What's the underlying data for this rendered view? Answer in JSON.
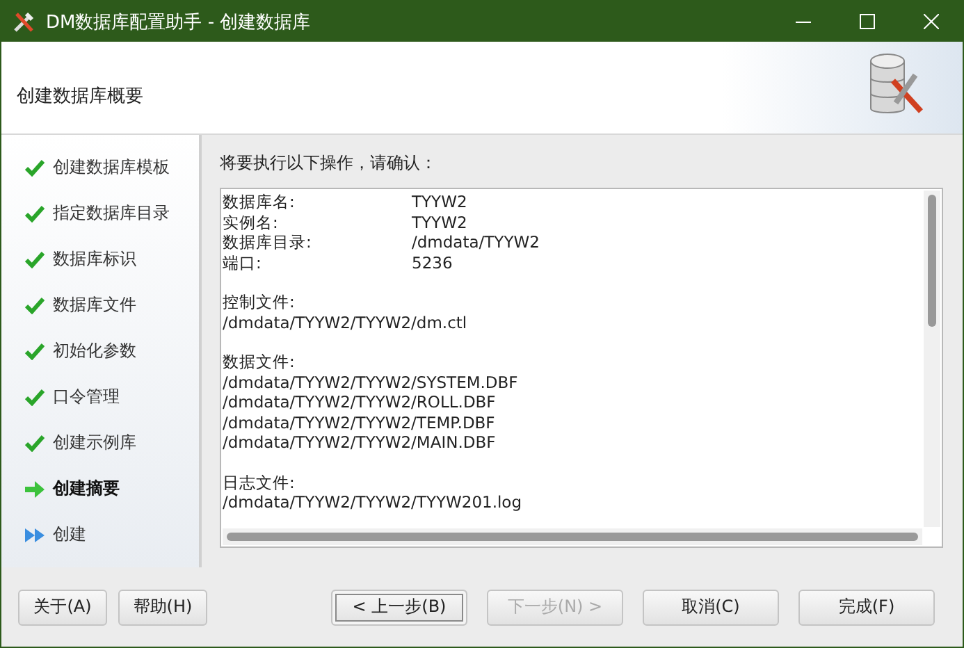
{
  "window": {
    "title": "DM数据库配置助手 - 创建数据库"
  },
  "header": {
    "title": "创建数据库概要"
  },
  "steps": [
    {
      "label": "创建数据库模板",
      "kind": "done"
    },
    {
      "label": "指定数据库目录",
      "kind": "done"
    },
    {
      "label": "数据库标识",
      "kind": "done"
    },
    {
      "label": "数据库文件",
      "kind": "done"
    },
    {
      "label": "初始化参数",
      "kind": "done"
    },
    {
      "label": "口令管理",
      "kind": "done"
    },
    {
      "label": "创建示例库",
      "kind": "done"
    },
    {
      "label": "创建摘要",
      "kind": "current"
    },
    {
      "label": "创建",
      "kind": "pending"
    }
  ],
  "prompt": "将要执行以下操作，请确认：",
  "summary": {
    "sections": [
      {
        "kind": "pairs",
        "rows": [
          {
            "label": "数据库名:",
            "value": "TYYW2"
          },
          {
            "label": "实例名:",
            "value": "TYYW2"
          },
          {
            "label": "数据库目录:",
            "value": "/dmdata/TYYW2"
          },
          {
            "label": "端口:",
            "value": "5236"
          }
        ]
      },
      {
        "kind": "list",
        "heading": "控制文件:",
        "lines": [
          "/dmdata/TYYW2/TYYW2/dm.ctl"
        ]
      },
      {
        "kind": "list",
        "heading": "数据文件:",
        "lines": [
          "/dmdata/TYYW2/TYYW2/SYSTEM.DBF",
          "/dmdata/TYYW2/TYYW2/ROLL.DBF",
          "/dmdata/TYYW2/TYYW2/TEMP.DBF",
          "/dmdata/TYYW2/TYYW2/MAIN.DBF"
        ]
      },
      {
        "kind": "list",
        "heading": "日志文件:",
        "lines": [
          "/dmdata/TYYW2/TYYW2/TYYW201.log"
        ]
      }
    ]
  },
  "left_buttons": [
    {
      "label": "关于(A)",
      "disabled": false,
      "focused": false
    },
    {
      "label": "帮助(H)",
      "disabled": false,
      "focused": false
    }
  ],
  "right_buttons": [
    {
      "label": "< 上一步(B)",
      "disabled": false,
      "focused": true
    },
    {
      "label": "下一步(N) >",
      "disabled": true,
      "focused": false
    },
    {
      "label": "取消(C)",
      "disabled": false,
      "focused": false
    },
    {
      "label": "完成(F)",
      "disabled": false,
      "focused": false
    }
  ]
}
